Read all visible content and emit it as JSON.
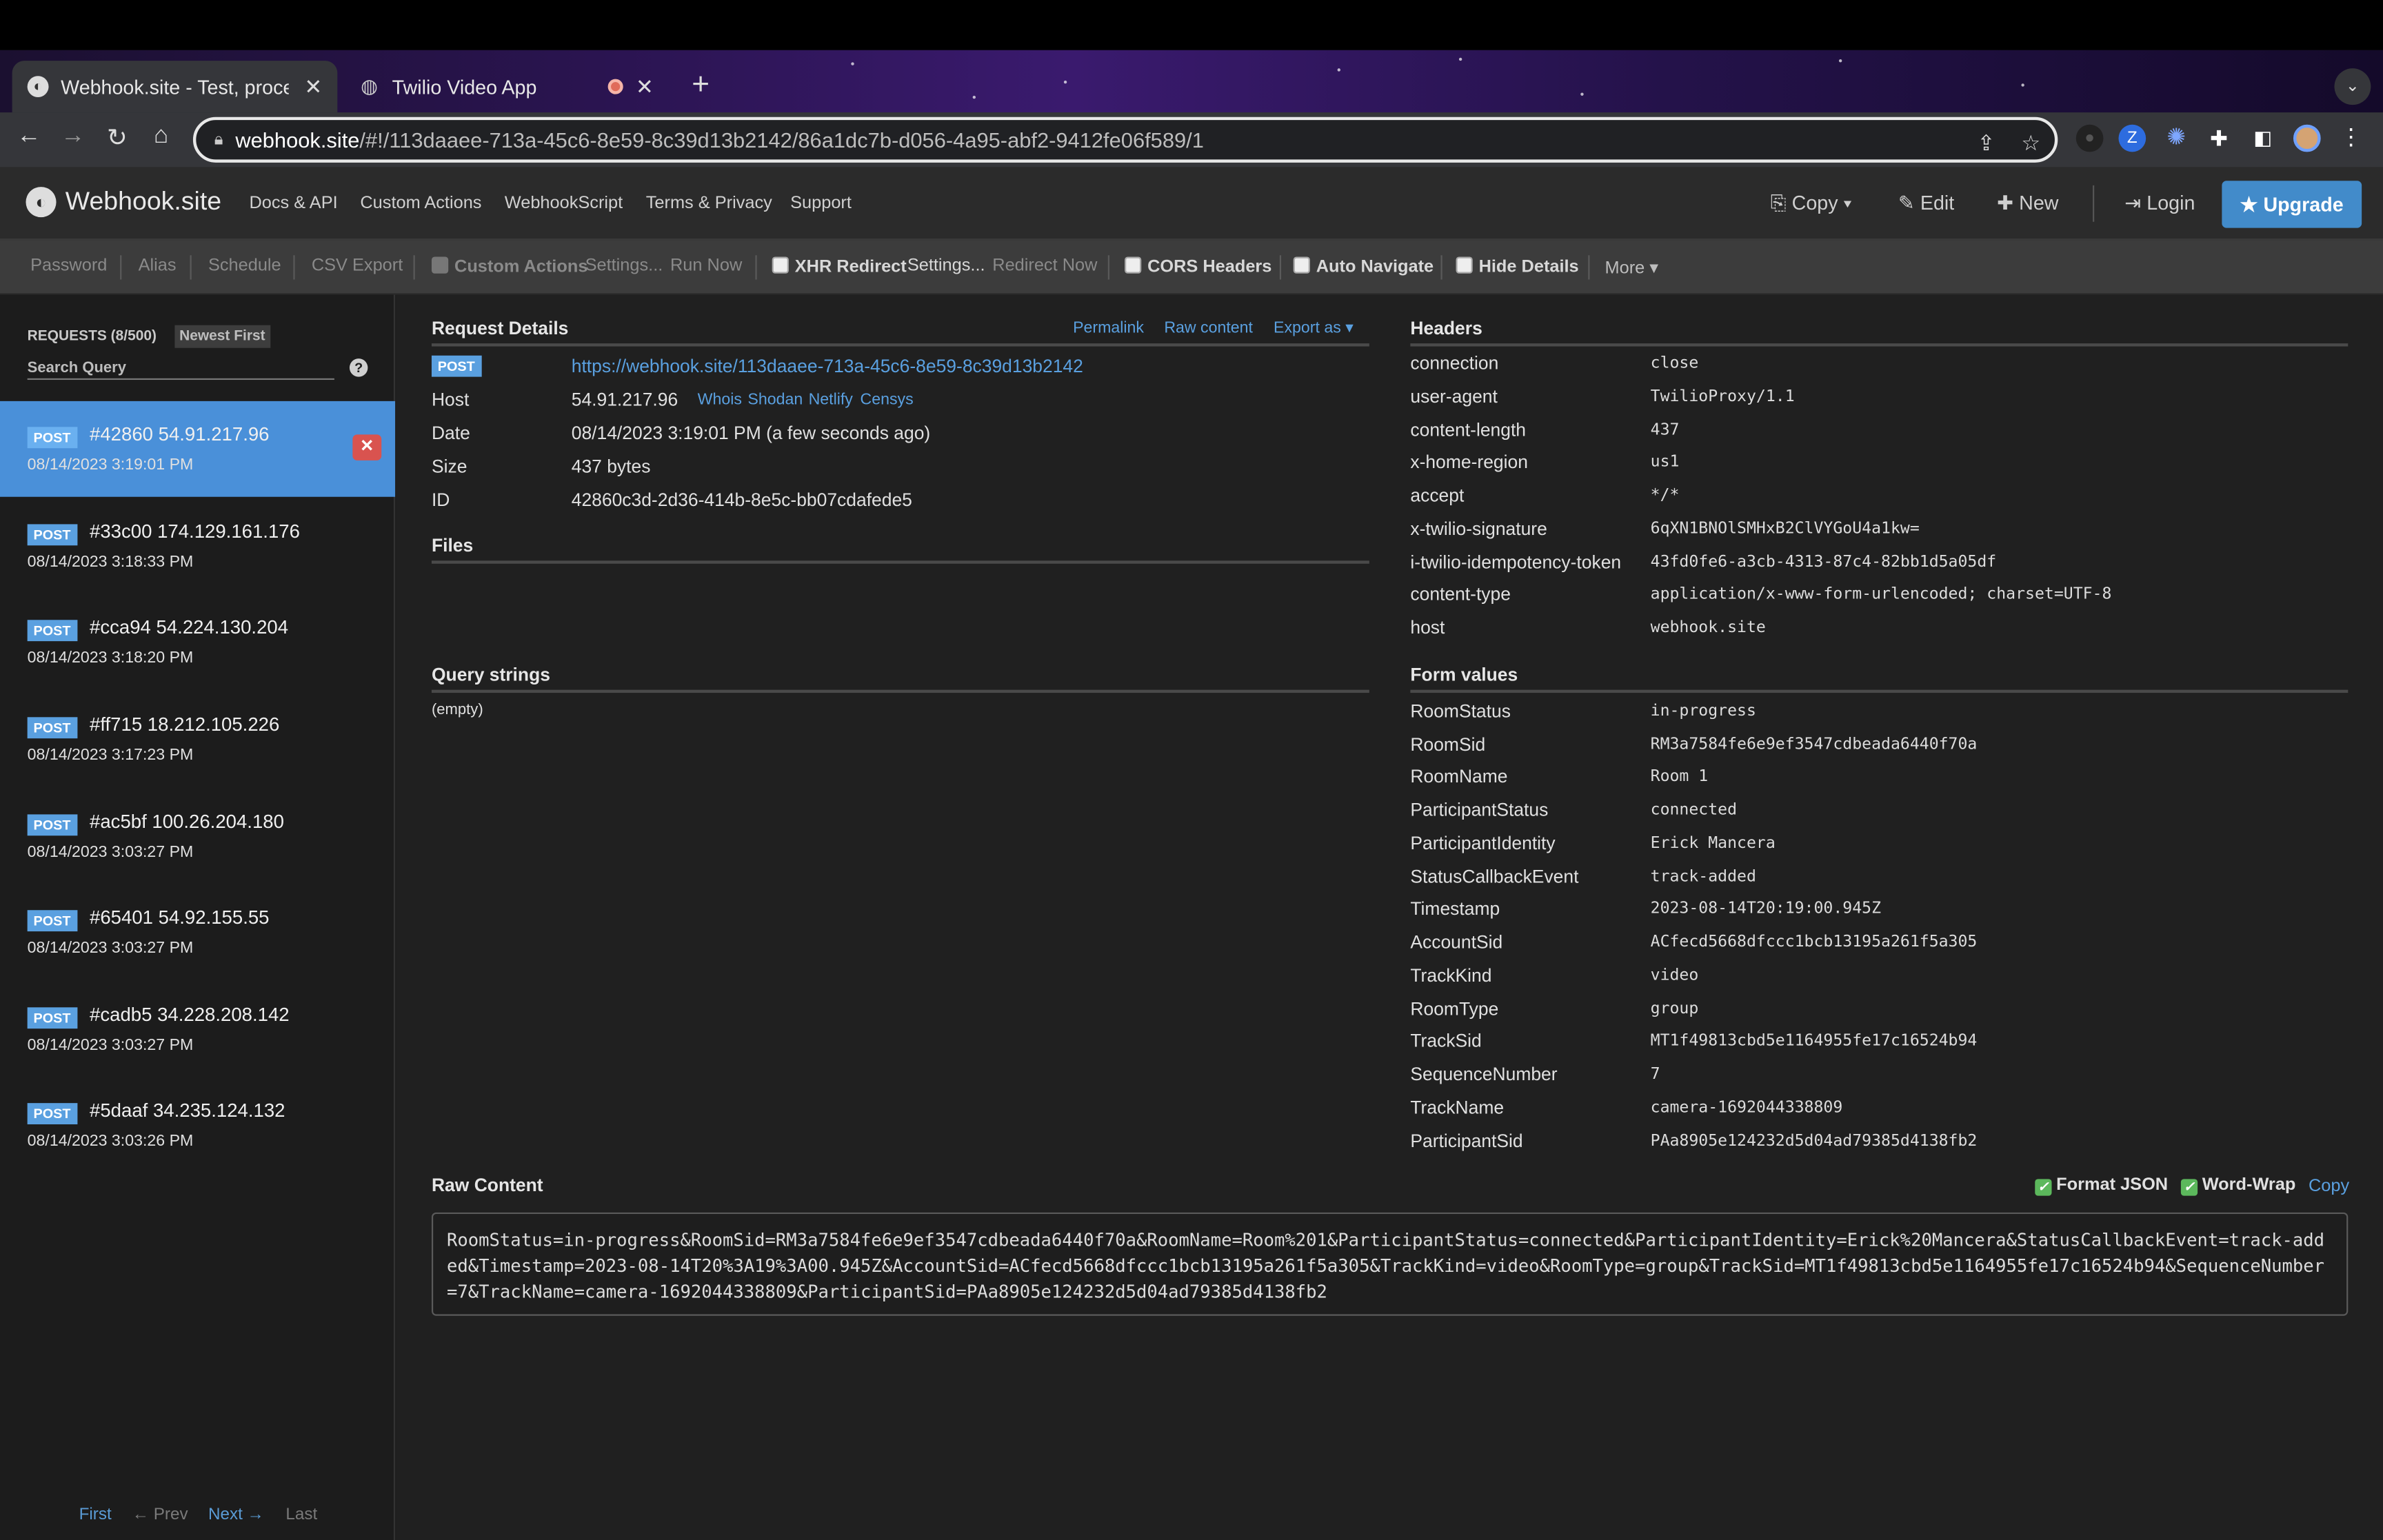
{
  "browser": {
    "tabs": [
      {
        "title": "Webhook.site - Test, process a",
        "close": "✕"
      },
      {
        "title": "Twilio Video App",
        "close": "✕"
      }
    ],
    "url_host": "webhook.site",
    "url_path": "/#!/113daaee-713a-45c6-8e59-8c39d13b2142/86a1dc7b-d056-4a95-abf2-9412fe06f589/1"
  },
  "header": {
    "logo": "Webhook.site",
    "nav": [
      "Docs & API",
      "Custom Actions",
      "WebhookScript",
      "Terms & Privacy",
      "Support"
    ],
    "copy": "Copy ▾",
    "edit": "Edit",
    "new": "New",
    "login": "Login",
    "upgrade": "Upgrade"
  },
  "toolbar": {
    "password": "Password",
    "alias": "Alias",
    "schedule": "Schedule",
    "csv_export": "CSV Export",
    "custom_actions": "Custom Actions",
    "ca_settings": "Settings...",
    "run_now": "Run Now",
    "xhr_redirect": "XHR Redirect",
    "xhr_settings": "Settings...",
    "redirect_now": "Redirect Now",
    "cors": "CORS Headers",
    "auto_navigate": "Auto Navigate",
    "hide_details": "Hide Details",
    "more": "More ▾"
  },
  "sidebar": {
    "heading": "REQUESTS (8/500)",
    "sort": "Newest First",
    "search_placeholder": "Search Query",
    "requests": [
      {
        "method": "POST",
        "title": "#42860 54.91.217.96",
        "date": "08/14/2023 3:19:01 PM"
      },
      {
        "method": "POST",
        "title": "#33c00 174.129.161.176",
        "date": "08/14/2023 3:18:33 PM"
      },
      {
        "method": "POST",
        "title": "#cca94 54.224.130.204",
        "date": "08/14/2023 3:18:20 PM"
      },
      {
        "method": "POST",
        "title": "#ff715 18.212.105.226",
        "date": "08/14/2023 3:17:23 PM"
      },
      {
        "method": "POST",
        "title": "#ac5bf 100.26.204.180",
        "date": "08/14/2023 3:03:27 PM"
      },
      {
        "method": "POST",
        "title": "#65401 54.92.155.55",
        "date": "08/14/2023 3:03:27 PM"
      },
      {
        "method": "POST",
        "title": "#cadb5 34.228.208.142",
        "date": "08/14/2023 3:03:27 PM"
      },
      {
        "method": "POST",
        "title": "#5daaf 34.235.124.132",
        "date": "08/14/2023 3:03:26 PM"
      }
    ],
    "pager": {
      "first": "First",
      "prev": "← Prev",
      "next": "Next →",
      "last": "Last"
    }
  },
  "details": {
    "title": "Request Details",
    "permalink": "Permalink",
    "raw_content_link": "Raw content",
    "export": "Export as ▾",
    "method": "POST",
    "url": "https://webhook.site/113daaee-713a-45c6-8e59-8c39d13b2142",
    "rows": [
      {
        "label": "Host",
        "value": "54.91.217.96"
      },
      {
        "label": "Date",
        "value": "08/14/2023 3:19:01 PM (a few seconds ago)"
      },
      {
        "label": "Size",
        "value": "437 bytes"
      },
      {
        "label": "ID",
        "value": "42860c3d-2d36-414b-8e5c-bb07cdafede5"
      }
    ],
    "host_links": [
      "Whois",
      "Shodan",
      "Netlify",
      "Censys"
    ],
    "files_title": "Files",
    "query_title": "Query strings",
    "query_empty": "(empty)"
  },
  "headers": {
    "title": "Headers",
    "rows": [
      {
        "k": "connection",
        "v": "close"
      },
      {
        "k": "user-agent",
        "v": "TwilioProxy/1.1"
      },
      {
        "k": "content-length",
        "v": "437"
      },
      {
        "k": "x-home-region",
        "v": "us1"
      },
      {
        "k": "accept",
        "v": "*/*"
      },
      {
        "k": "x-twilio-signature",
        "v": "6qXN1BNOlSMHxB2ClVYGoU4a1kw="
      },
      {
        "k": "i-twilio-idempotency-token",
        "v": "43fd0fe6-a3cb-4313-87c4-82bb1d5a05df"
      },
      {
        "k": "content-type",
        "v": "application/x-www-form-urlencoded; charset=UTF-8"
      },
      {
        "k": "host",
        "v": "webhook.site"
      }
    ]
  },
  "form": {
    "title": "Form values",
    "rows": [
      {
        "k": "RoomStatus",
        "v": "in-progress"
      },
      {
        "k": "RoomSid",
        "v": "RM3a7584fe6e9ef3547cdbeada6440f70a"
      },
      {
        "k": "RoomName",
        "v": "Room 1"
      },
      {
        "k": "ParticipantStatus",
        "v": "connected"
      },
      {
        "k": "ParticipantIdentity",
        "v": "Erick Mancera"
      },
      {
        "k": "StatusCallbackEvent",
        "v": "track-added"
      },
      {
        "k": "Timestamp",
        "v": "2023-08-14T20:19:00.945Z"
      },
      {
        "k": "AccountSid",
        "v": "ACfecd5668dfccc1bcb13195a261f5a305"
      },
      {
        "k": "TrackKind",
        "v": "video"
      },
      {
        "k": "RoomType",
        "v": "group"
      },
      {
        "k": "TrackSid",
        "v": "MT1f49813cbd5e1164955fe17c16524b94"
      },
      {
        "k": "SequenceNumber",
        "v": "7"
      },
      {
        "k": "TrackName",
        "v": "camera-1692044338809"
      },
      {
        "k": "ParticipantSid",
        "v": "PAa8905e124232d5d04ad79385d4138fb2"
      }
    ]
  },
  "raw": {
    "title": "Raw Content",
    "format_json": "Format JSON",
    "word_wrap": "Word-Wrap",
    "copy": "Copy",
    "body": "RoomStatus=in-progress&RoomSid=RM3a7584fe6e9ef3547cdbeada6440f70a&RoomName=Room%201&ParticipantStatus=connected&ParticipantIdentity=Erick%20Mancera&StatusCallbackEvent=track-added&Timestamp=2023-08-14T20%3A19%3A00.945Z&AccountSid=ACfecd5668dfccc1bcb13195a261f5a305&TrackKind=video&RoomType=group&TrackSid=MT1f49813cbd5e1164955fe17c16524b94&SequenceNumber=7&TrackName=camera-1692044338809&ParticipantSid=PAa8905e124232d5d04ad79385d4138fb2"
  },
  "colors": {
    "accent": "#428bca",
    "active_request": "#4a90d9",
    "delete": "#d9534f",
    "check": "#5cb85c"
  }
}
